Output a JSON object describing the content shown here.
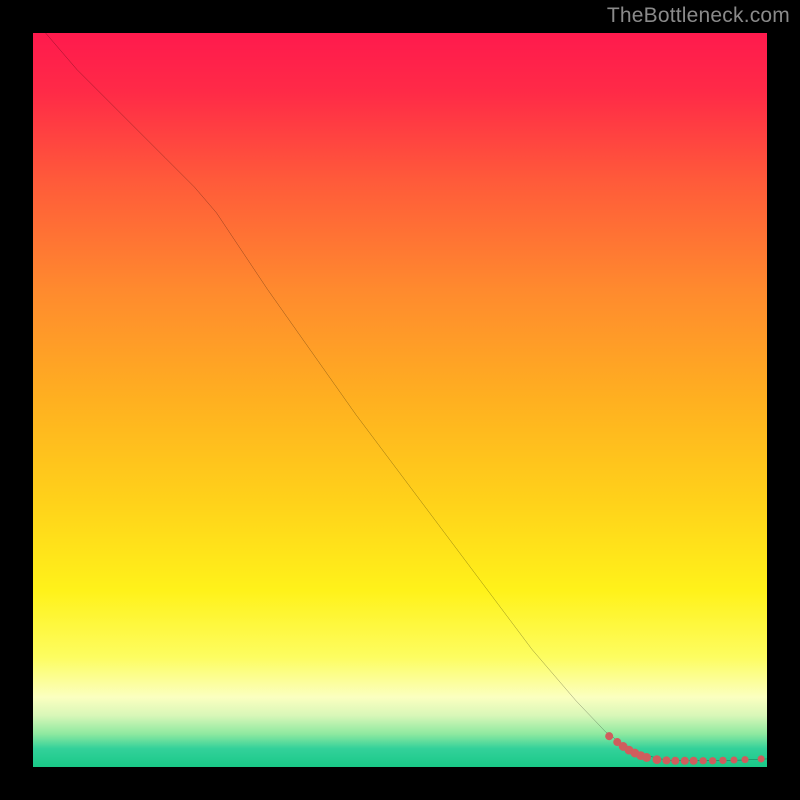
{
  "watermark": "TheBottleneck.com",
  "chart_data": {
    "type": "line",
    "title": "",
    "xlabel": "",
    "ylabel": "",
    "xlim": [
      0,
      100
    ],
    "ylim": [
      0,
      100
    ],
    "grid": false,
    "legend": false,
    "gradient_stops": [
      {
        "offset": 0.0,
        "color": "#ff1a4d"
      },
      {
        "offset": 0.08,
        "color": "#ff2a47"
      },
      {
        "offset": 0.2,
        "color": "#ff5a3a"
      },
      {
        "offset": 0.35,
        "color": "#ff8a2e"
      },
      {
        "offset": 0.5,
        "color": "#ffb020"
      },
      {
        "offset": 0.64,
        "color": "#ffd21a"
      },
      {
        "offset": 0.76,
        "color": "#fff21a"
      },
      {
        "offset": 0.85,
        "color": "#fdfd60"
      },
      {
        "offset": 0.905,
        "color": "#fbffc0"
      },
      {
        "offset": 0.93,
        "color": "#d8f7b8"
      },
      {
        "offset": 0.955,
        "color": "#8ee9a0"
      },
      {
        "offset": 0.975,
        "color": "#33d19a"
      },
      {
        "offset": 1.0,
        "color": "#19c987"
      }
    ],
    "series": [
      {
        "name": "bottleneck_curve",
        "x": [
          0,
          6,
          12,
          18,
          22,
          25,
          28,
          32,
          38,
          44,
          50,
          56,
          62,
          68,
          74,
          78,
          81,
          83.5,
          85.5,
          87,
          89,
          91,
          94,
          97,
          100
        ],
        "y": [
          102,
          95,
          89,
          83,
          79,
          75.5,
          71,
          65,
          56.5,
          48,
          40,
          32,
          24,
          16,
          9,
          4.8,
          2.6,
          1.6,
          1.1,
          0.9,
          0.85,
          0.85,
          0.9,
          0.95,
          1.1
        ]
      }
    ],
    "scatter": {
      "name": "sample_points",
      "color": "#cf5d5d",
      "points": [
        {
          "x": 78.5,
          "y": 4.2,
          "r": 0.55
        },
        {
          "x": 79.6,
          "y": 3.4,
          "r": 0.55
        },
        {
          "x": 80.4,
          "y": 2.8,
          "r": 0.6
        },
        {
          "x": 81.2,
          "y": 2.3,
          "r": 0.6
        },
        {
          "x": 82.0,
          "y": 1.9,
          "r": 0.6
        },
        {
          "x": 82.8,
          "y": 1.55,
          "r": 0.6
        },
        {
          "x": 83.6,
          "y": 1.3,
          "r": 0.6
        },
        {
          "x": 85.0,
          "y": 1.0,
          "r": 0.6
        },
        {
          "x": 86.3,
          "y": 0.9,
          "r": 0.55
        },
        {
          "x": 87.5,
          "y": 0.85,
          "r": 0.55
        },
        {
          "x": 88.8,
          "y": 0.85,
          "r": 0.55
        },
        {
          "x": 90.0,
          "y": 0.85,
          "r": 0.55
        },
        {
          "x": 91.3,
          "y": 0.85,
          "r": 0.5
        },
        {
          "x": 92.6,
          "y": 0.85,
          "r": 0.5
        },
        {
          "x": 94.0,
          "y": 0.9,
          "r": 0.5
        },
        {
          "x": 95.5,
          "y": 0.95,
          "r": 0.48
        },
        {
          "x": 97.0,
          "y": 1.0,
          "r": 0.48
        },
        {
          "x": 99.2,
          "y": 1.1,
          "r": 0.48
        }
      ]
    }
  }
}
